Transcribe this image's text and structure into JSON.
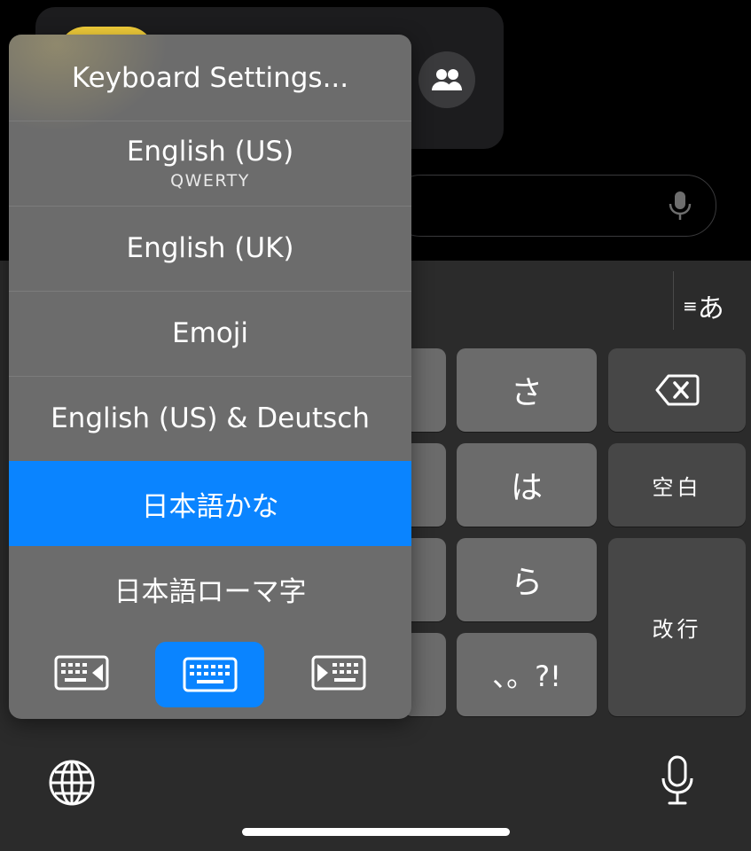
{
  "app": {
    "accent": "#0a84ff",
    "key_color": "#6b6b6b",
    "special_key_color": "#474747"
  },
  "keyboard": {
    "mode_switch_label": "あ",
    "keys": {
      "sa": "さ",
      "ha": "は",
      "ra": "ら",
      "punct": "、。?!",
      "space": "空白",
      "return": "改行"
    },
    "icons": [
      "delete-icon",
      "globe-icon",
      "microphone-icon"
    ]
  },
  "menu": {
    "items": [
      {
        "label": "Keyboard Settings...",
        "sublabel": ""
      },
      {
        "label": "English (US)",
        "sublabel": "QWERTY"
      },
      {
        "label": "English (UK)",
        "sublabel": ""
      },
      {
        "label": "Emoji",
        "sublabel": ""
      },
      {
        "label": "English (US) & Deutsch",
        "sublabel": ""
      },
      {
        "label": "日本語かな",
        "sublabel": "",
        "selected": true
      },
      {
        "label": "日本語ローマ字",
        "sublabel": ""
      }
    ],
    "layout_buttons": [
      "keyboard-left-icon",
      "keyboard-full-icon",
      "keyboard-right-icon"
    ],
    "active_layout": "keyboard-full-icon"
  }
}
